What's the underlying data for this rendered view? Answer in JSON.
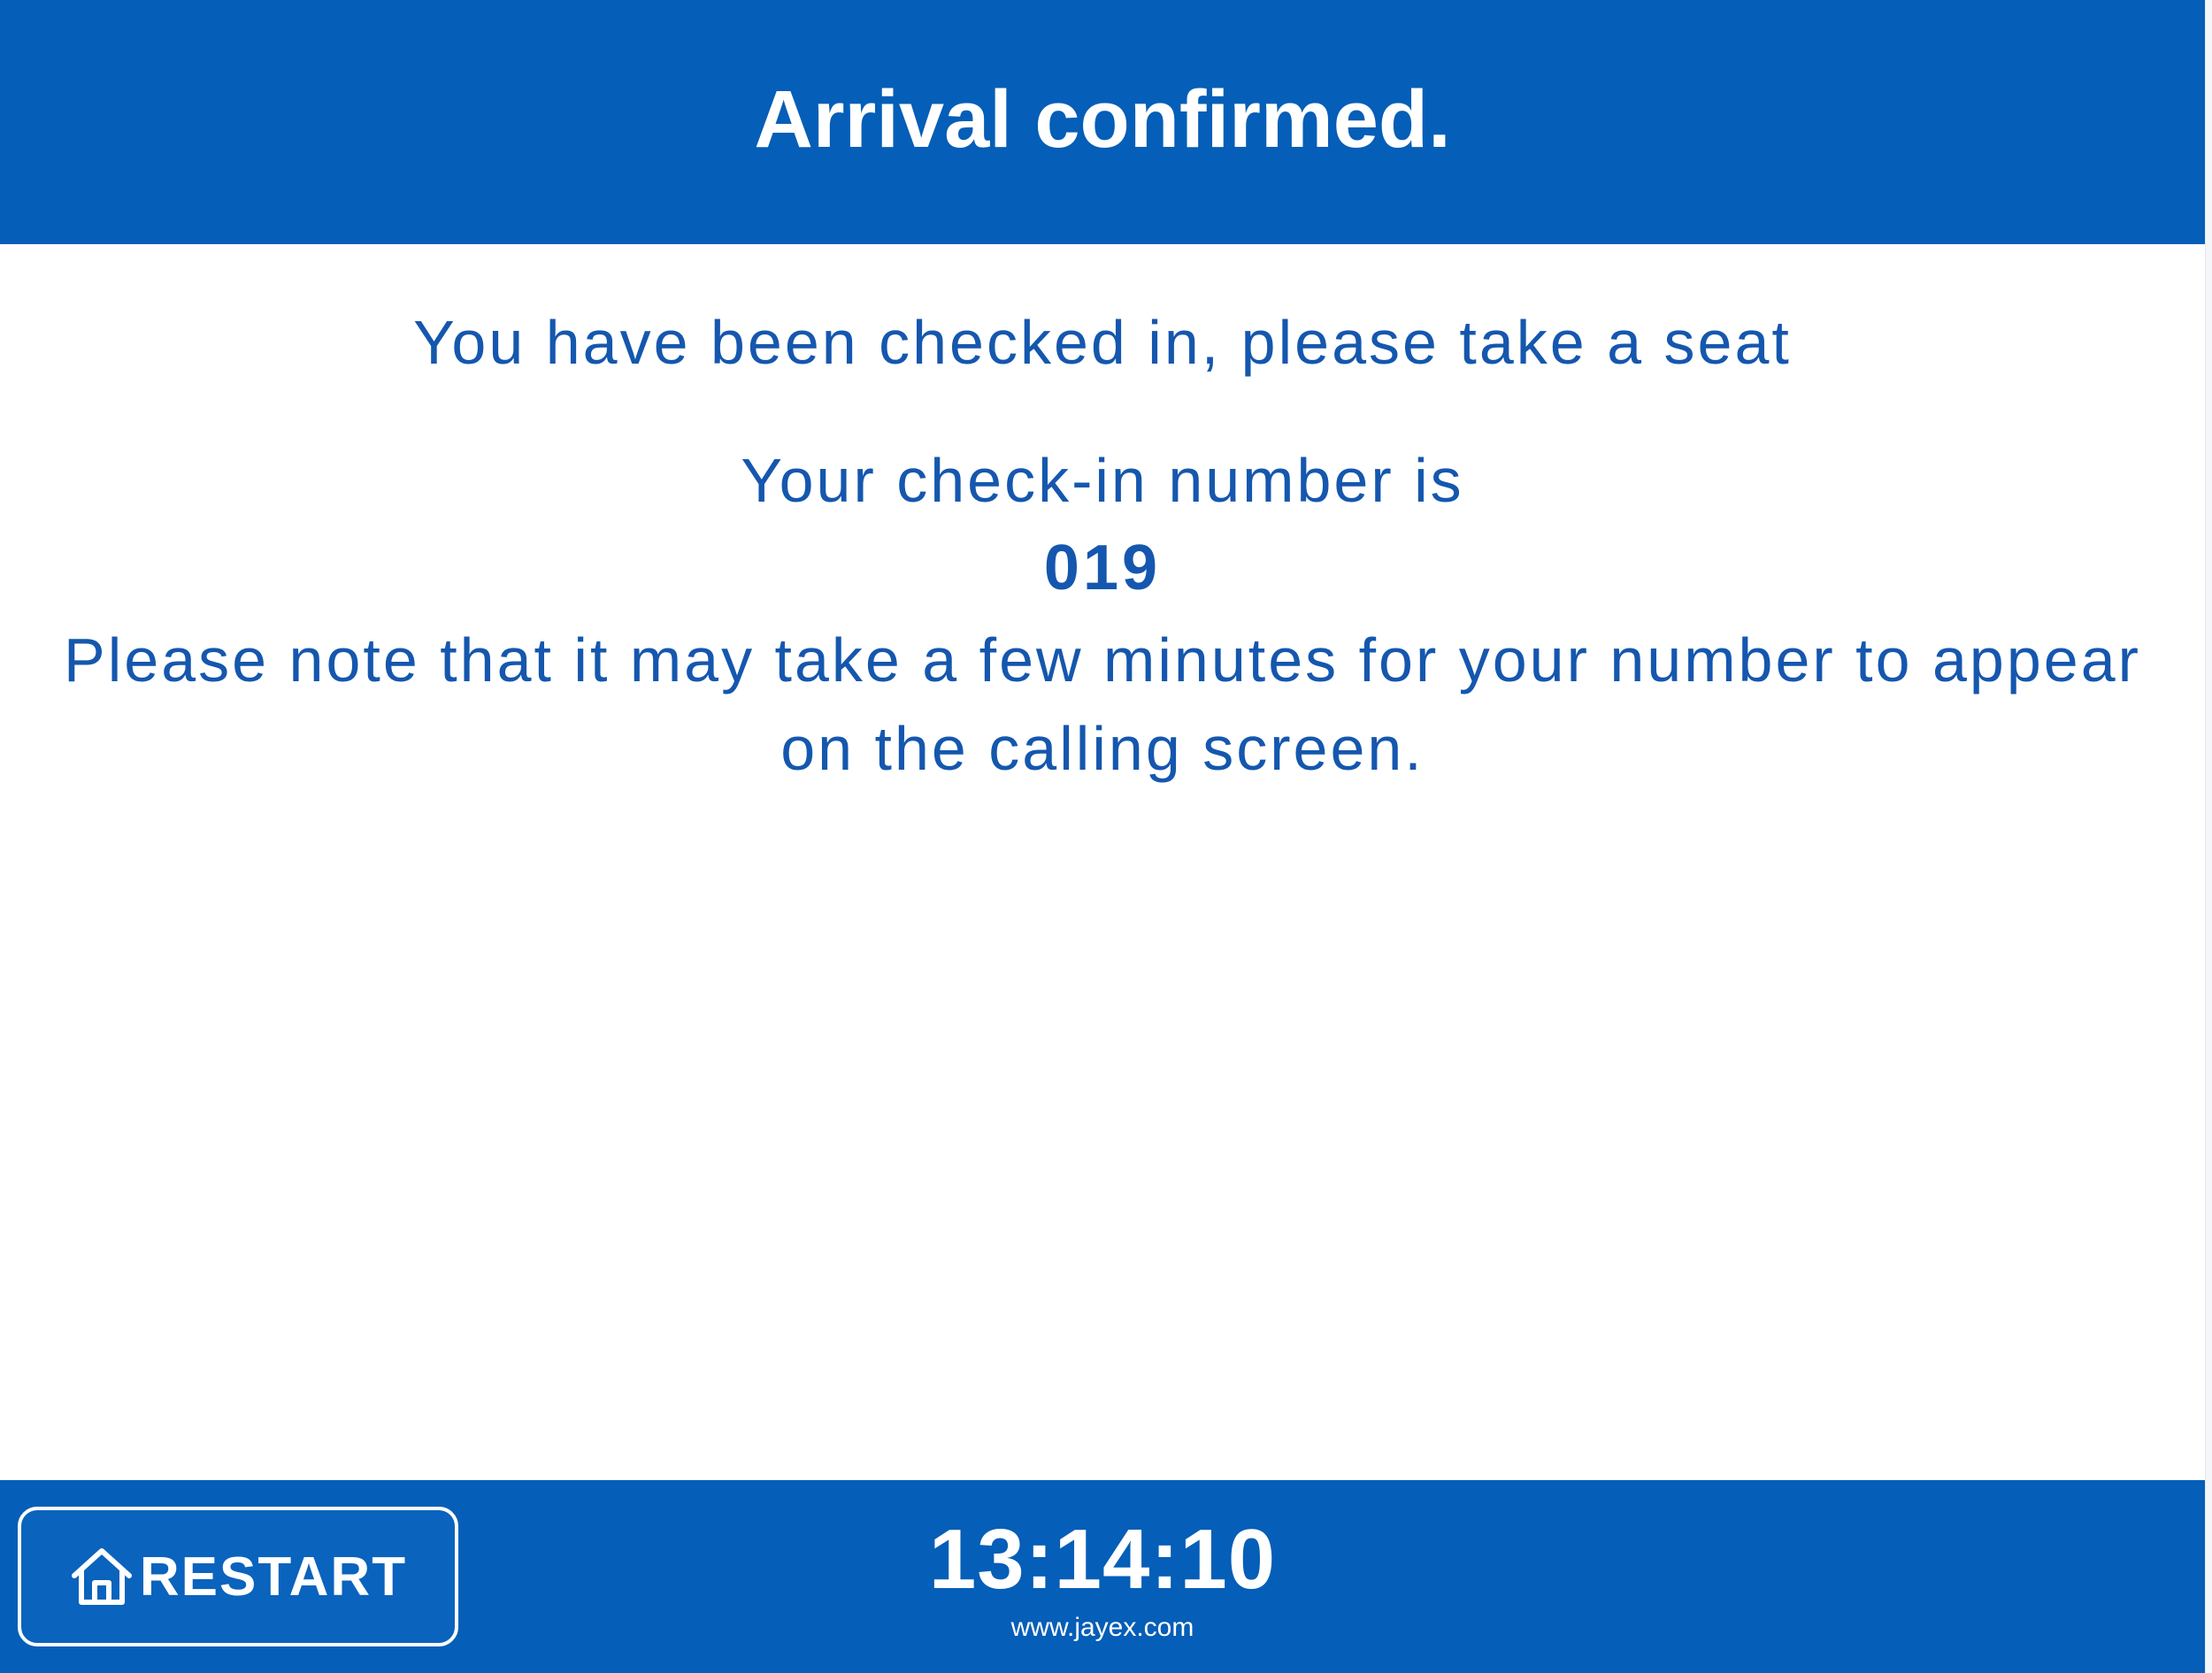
{
  "header": {
    "title": "Arrival confirmed."
  },
  "main": {
    "checked_in_message": "You have been checked in, please take a seat",
    "checkin_number_label": "Your check-in number is",
    "checkin_number": "019",
    "note": "Please note that it may take a few minutes for your number to appear on the calling screen."
  },
  "footer": {
    "restart_label": "RESTART",
    "restart_icon": "home-icon",
    "clock": "13:14:10",
    "website": "www.jayex.com"
  },
  "colors": {
    "brand_blue": "#055eb7",
    "text_blue": "#1557ae",
    "background": "#ffffff"
  }
}
